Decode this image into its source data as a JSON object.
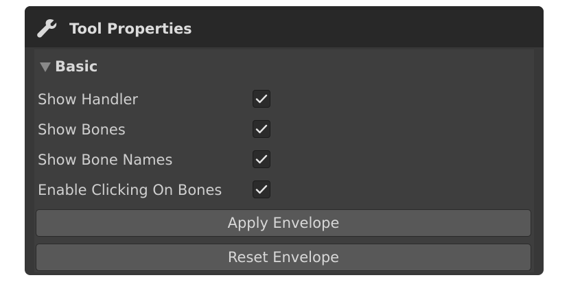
{
  "panel": {
    "title": "Tool Properties",
    "icon": "wrench-icon"
  },
  "section": {
    "label": "Basic",
    "expanded": true
  },
  "options": [
    {
      "label": "Show Handler",
      "checked": true
    },
    {
      "label": "Show Bones",
      "checked": true
    },
    {
      "label": "Show Bone Names",
      "checked": true
    },
    {
      "label": "Enable Clicking On Bones",
      "checked": true
    }
  ],
  "buttons": {
    "apply_label": "Apply Envelope",
    "reset_label": "Reset Envelope"
  },
  "colors": {
    "panel_bg": "#383838",
    "header_bg": "#282828",
    "content_bg": "#3e3e3e",
    "button_bg": "#585858",
    "text": "#d8d8d8"
  }
}
